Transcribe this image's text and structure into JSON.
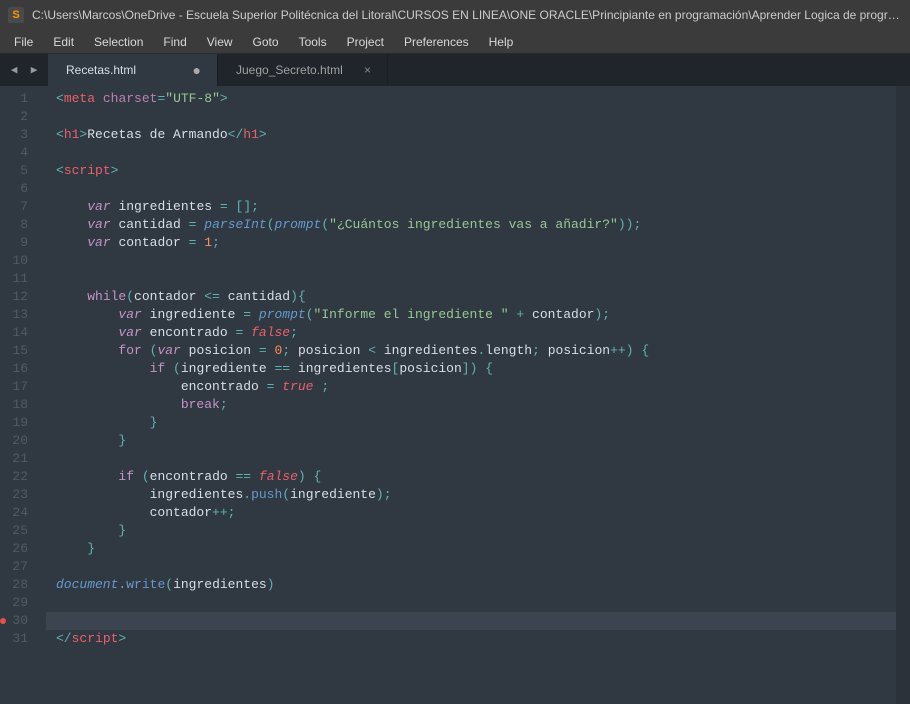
{
  "titlebar": {
    "icon_letter": "S",
    "title": "C:\\Users\\Marcos\\OneDrive - Escuela Superior Politécnica del Litoral\\CURSOS EN LINEA\\ONE ORACLE\\Principiante en programación\\Aprender Logica de progra..."
  },
  "menu": [
    "File",
    "Edit",
    "Selection",
    "Find",
    "View",
    "Goto",
    "Tools",
    "Project",
    "Preferences",
    "Help"
  ],
  "tabs": [
    {
      "label": "Recetas.html",
      "active": true,
      "dirty": true
    },
    {
      "label": "Juego_Secreto.html",
      "active": false,
      "dirty": false
    }
  ],
  "nav": {
    "left": "◀",
    "right": "▶"
  },
  "close_glyph": "×",
  "dirty_glyph": "●",
  "line_count": 31,
  "highlighted_line": 30,
  "code": {
    "l1_tag": "meta",
    "l1_attr": "charset",
    "l1_val": "\"UTF-8\"",
    "l3_tag": "h1",
    "l3_text": "Recetas de Armando",
    "l5_tag": "script",
    "l7_var": "var",
    "l7_name": "ingredientes",
    "l8_name": "cantidad",
    "l8_pint": "parseInt",
    "l8_prompt": "prompt",
    "l8_str": "\"¿Cuántos ingredientes vas a añadir?\"",
    "l9_name": "contador",
    "l9_val": "1",
    "l12_while": "while",
    "l13_name": "ingrediente",
    "l13_str": "\"Informe el ingrediente \"",
    "l14_name": "encontrado",
    "l14_false": "false",
    "l15_for": "for",
    "l15_name": "posicion",
    "l15_zero": "0",
    "l15_len": "length",
    "l16_if": "if",
    "l17_true": "true",
    "l18_break": "break",
    "l22_false": "false",
    "l23_push": "push",
    "l28_doc": "document",
    "l28_write": "write",
    "l31_tag": "script"
  }
}
